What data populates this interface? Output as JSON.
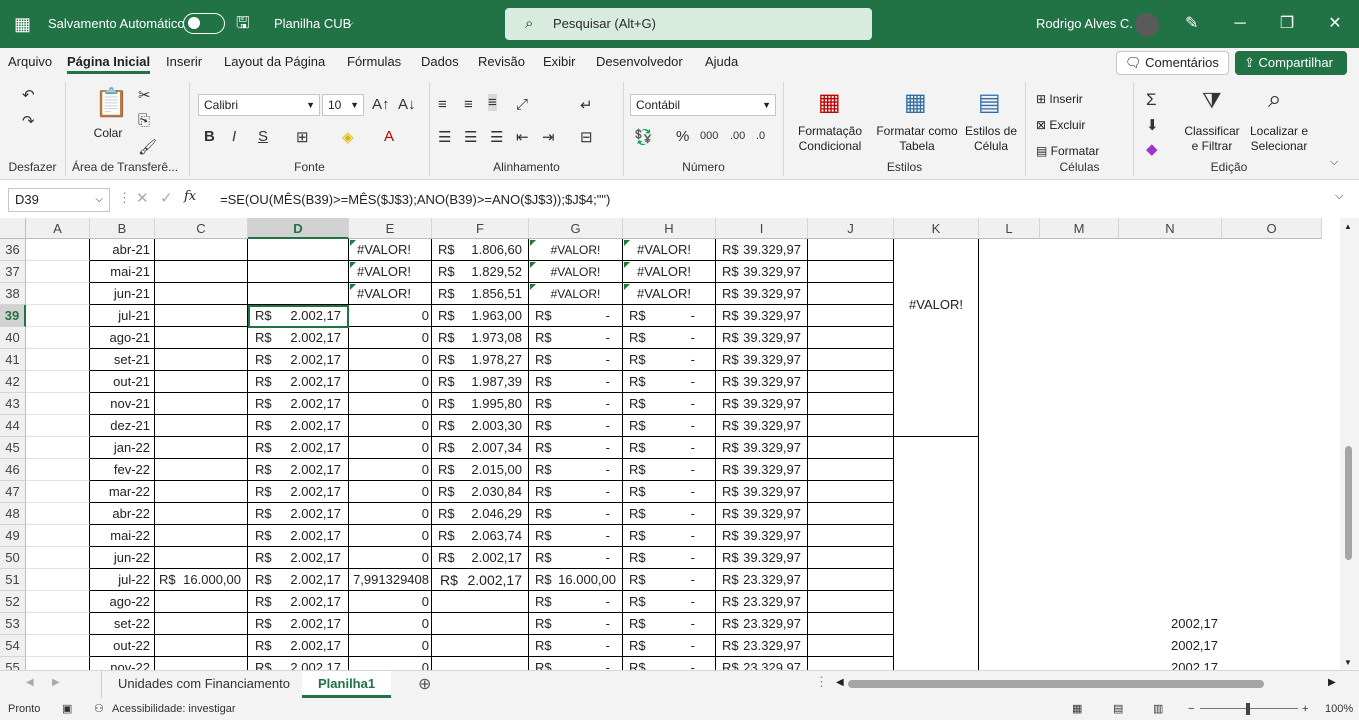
{
  "title": {
    "autosave": "Salvamento Automático",
    "doc": "Planilha CUB",
    "search": "Pesquisar (Alt+G)",
    "user": "Rodrigo Alves C."
  },
  "menu": [
    "Arquivo",
    "Página Inicial",
    "Inserir",
    "Layout da Página",
    "Fórmulas",
    "Dados",
    "Revisão",
    "Exibir",
    "Desenvolvedor",
    "Ajuda"
  ],
  "comments": "Comentários",
  "share": "Compartilhar",
  "ribbon": {
    "undo": "Desfazer",
    "paste": "Colar",
    "clipboard": "Área de Transferê...",
    "font_name": "Calibri",
    "font_size": "10",
    "font": "Fonte",
    "align": "Alinhamento",
    "numfmt": "Contábil",
    "number": "Número",
    "cond": "Formatação Condicional",
    "table": "Formatar como Tabela",
    "cellstyle": "Estilos de Célula",
    "styles": "Estilos",
    "insert": "Inserir",
    "delete": "Excluir",
    "format": "Formatar",
    "cells": "Células",
    "sort": "Classificar e Filtrar",
    "find": "Localizar e Selecionar",
    "edit": "Edição"
  },
  "namebox": "D39",
  "formula": "=SE(OU(MÊS(B39)>=MÊS($J$3);ANO(B39)>=ANO($J$3));$J$4;\"\")",
  "columns": [
    "A",
    "B",
    "C",
    "D",
    "E",
    "F",
    "G",
    "H",
    "I",
    "J",
    "K",
    "L",
    "M",
    "N",
    "O"
  ],
  "rows": [
    {
      "n": "36",
      "b": "abr-21",
      "c": "",
      "d": "",
      "e": "#VALOR!",
      "f": "1.806,60",
      "g": "#VALOR!",
      "h": "#VALOR!",
      "i": "39.329,97",
      "n2": ""
    },
    {
      "n": "37",
      "b": "mai-21",
      "c": "",
      "d": "",
      "e": "#VALOR!",
      "f": "1.829,52",
      "g": "#VALOR!",
      "h": "#VALOR!",
      "i": "39.329,97",
      "n2": ""
    },
    {
      "n": "38",
      "b": "jun-21",
      "c": "",
      "d": "",
      "e": "#VALOR!",
      "f": "1.856,51",
      "g": "#VALOR!",
      "h": "#VALOR!",
      "i": "39.329,97",
      "n2": ""
    },
    {
      "n": "39",
      "b": "jul-21",
      "c": "",
      "d": "2.002,17",
      "e": "0",
      "f": "1.963,00",
      "g": "-",
      "h": "-",
      "i": "39.329,97",
      "n2": ""
    },
    {
      "n": "40",
      "b": "ago-21",
      "c": "",
      "d": "2.002,17",
      "e": "0",
      "f": "1.973,08",
      "g": "-",
      "h": "-",
      "i": "39.329,97",
      "n2": ""
    },
    {
      "n": "41",
      "b": "set-21",
      "c": "",
      "d": "2.002,17",
      "e": "0",
      "f": "1.978,27",
      "g": "-",
      "h": "-",
      "i": "39.329,97",
      "n2": ""
    },
    {
      "n": "42",
      "b": "out-21",
      "c": "",
      "d": "2.002,17",
      "e": "0",
      "f": "1.987,39",
      "g": "-",
      "h": "-",
      "i": "39.329,97",
      "n2": ""
    },
    {
      "n": "43",
      "b": "nov-21",
      "c": "",
      "d": "2.002,17",
      "e": "0",
      "f": "1.995,80",
      "g": "-",
      "h": "-",
      "i": "39.329,97",
      "n2": ""
    },
    {
      "n": "44",
      "b": "dez-21",
      "c": "",
      "d": "2.002,17",
      "e": "0",
      "f": "2.003,30",
      "g": "-",
      "h": "-",
      "i": "39.329,97",
      "n2": ""
    },
    {
      "n": "45",
      "b": "jan-22",
      "c": "",
      "d": "2.002,17",
      "e": "0",
      "f": "2.007,34",
      "g": "-",
      "h": "-",
      "i": "39.329,97",
      "n2": ""
    },
    {
      "n": "46",
      "b": "fev-22",
      "c": "",
      "d": "2.002,17",
      "e": "0",
      "f": "2.015,00",
      "g": "-",
      "h": "-",
      "i": "39.329,97",
      "n2": ""
    },
    {
      "n": "47",
      "b": "mar-22",
      "c": "",
      "d": "2.002,17",
      "e": "0",
      "f": "2.030,84",
      "g": "-",
      "h": "-",
      "i": "39.329,97",
      "n2": ""
    },
    {
      "n": "48",
      "b": "abr-22",
      "c": "",
      "d": "2.002,17",
      "e": "0",
      "f": "2.046,29",
      "g": "-",
      "h": "-",
      "i": "39.329,97",
      "n2": ""
    },
    {
      "n": "49",
      "b": "mai-22",
      "c": "",
      "d": "2.002,17",
      "e": "0",
      "f": "2.063,74",
      "g": "-",
      "h": "-",
      "i": "39.329,97",
      "n2": ""
    },
    {
      "n": "50",
      "b": "jun-22",
      "c": "",
      "d": "2.002,17",
      "e": "0",
      "f": "2.002,17",
      "g": "-",
      "h": "-",
      "i": "39.329,97",
      "n2": ""
    },
    {
      "n": "51",
      "b": "jul-22",
      "c": "16.000,00",
      "d": "2.002,17",
      "e": "7,991329408",
      "f": "2.002,17",
      "g": "16.000,00",
      "h": "-",
      "i": "23.329,97",
      "n2": ""
    },
    {
      "n": "52",
      "b": "ago-22",
      "c": "",
      "d": "2.002,17",
      "e": "0",
      "f": "",
      "g": "-",
      "h": "-",
      "i": "23.329,97",
      "n2": ""
    },
    {
      "n": "53",
      "b": "set-22",
      "c": "",
      "d": "2.002,17",
      "e": "0",
      "f": "",
      "g": "-",
      "h": "-",
      "i": "23.329,97",
      "n2": "2002,17"
    },
    {
      "n": "54",
      "b": "out-22",
      "c": "",
      "d": "2.002,17",
      "e": "0",
      "f": "",
      "g": "-",
      "h": "-",
      "i": "23.329,97",
      "n2": "2002,17"
    },
    {
      "n": "55",
      "b": "nov-22",
      "c": "",
      "d": "2.002,17",
      "e": "0",
      "f": "",
      "g": "-",
      "h": "-",
      "i": "23.329,97",
      "n2": "2002,17"
    }
  ],
  "currency": "R$",
  "k_merged": "#VALOR!",
  "tabs": [
    "Unidades com Financiamento",
    "Planilha1"
  ],
  "status": {
    "ready": "Pronto",
    "access": "Acessibilidade: investigar",
    "zoom": "100%"
  }
}
